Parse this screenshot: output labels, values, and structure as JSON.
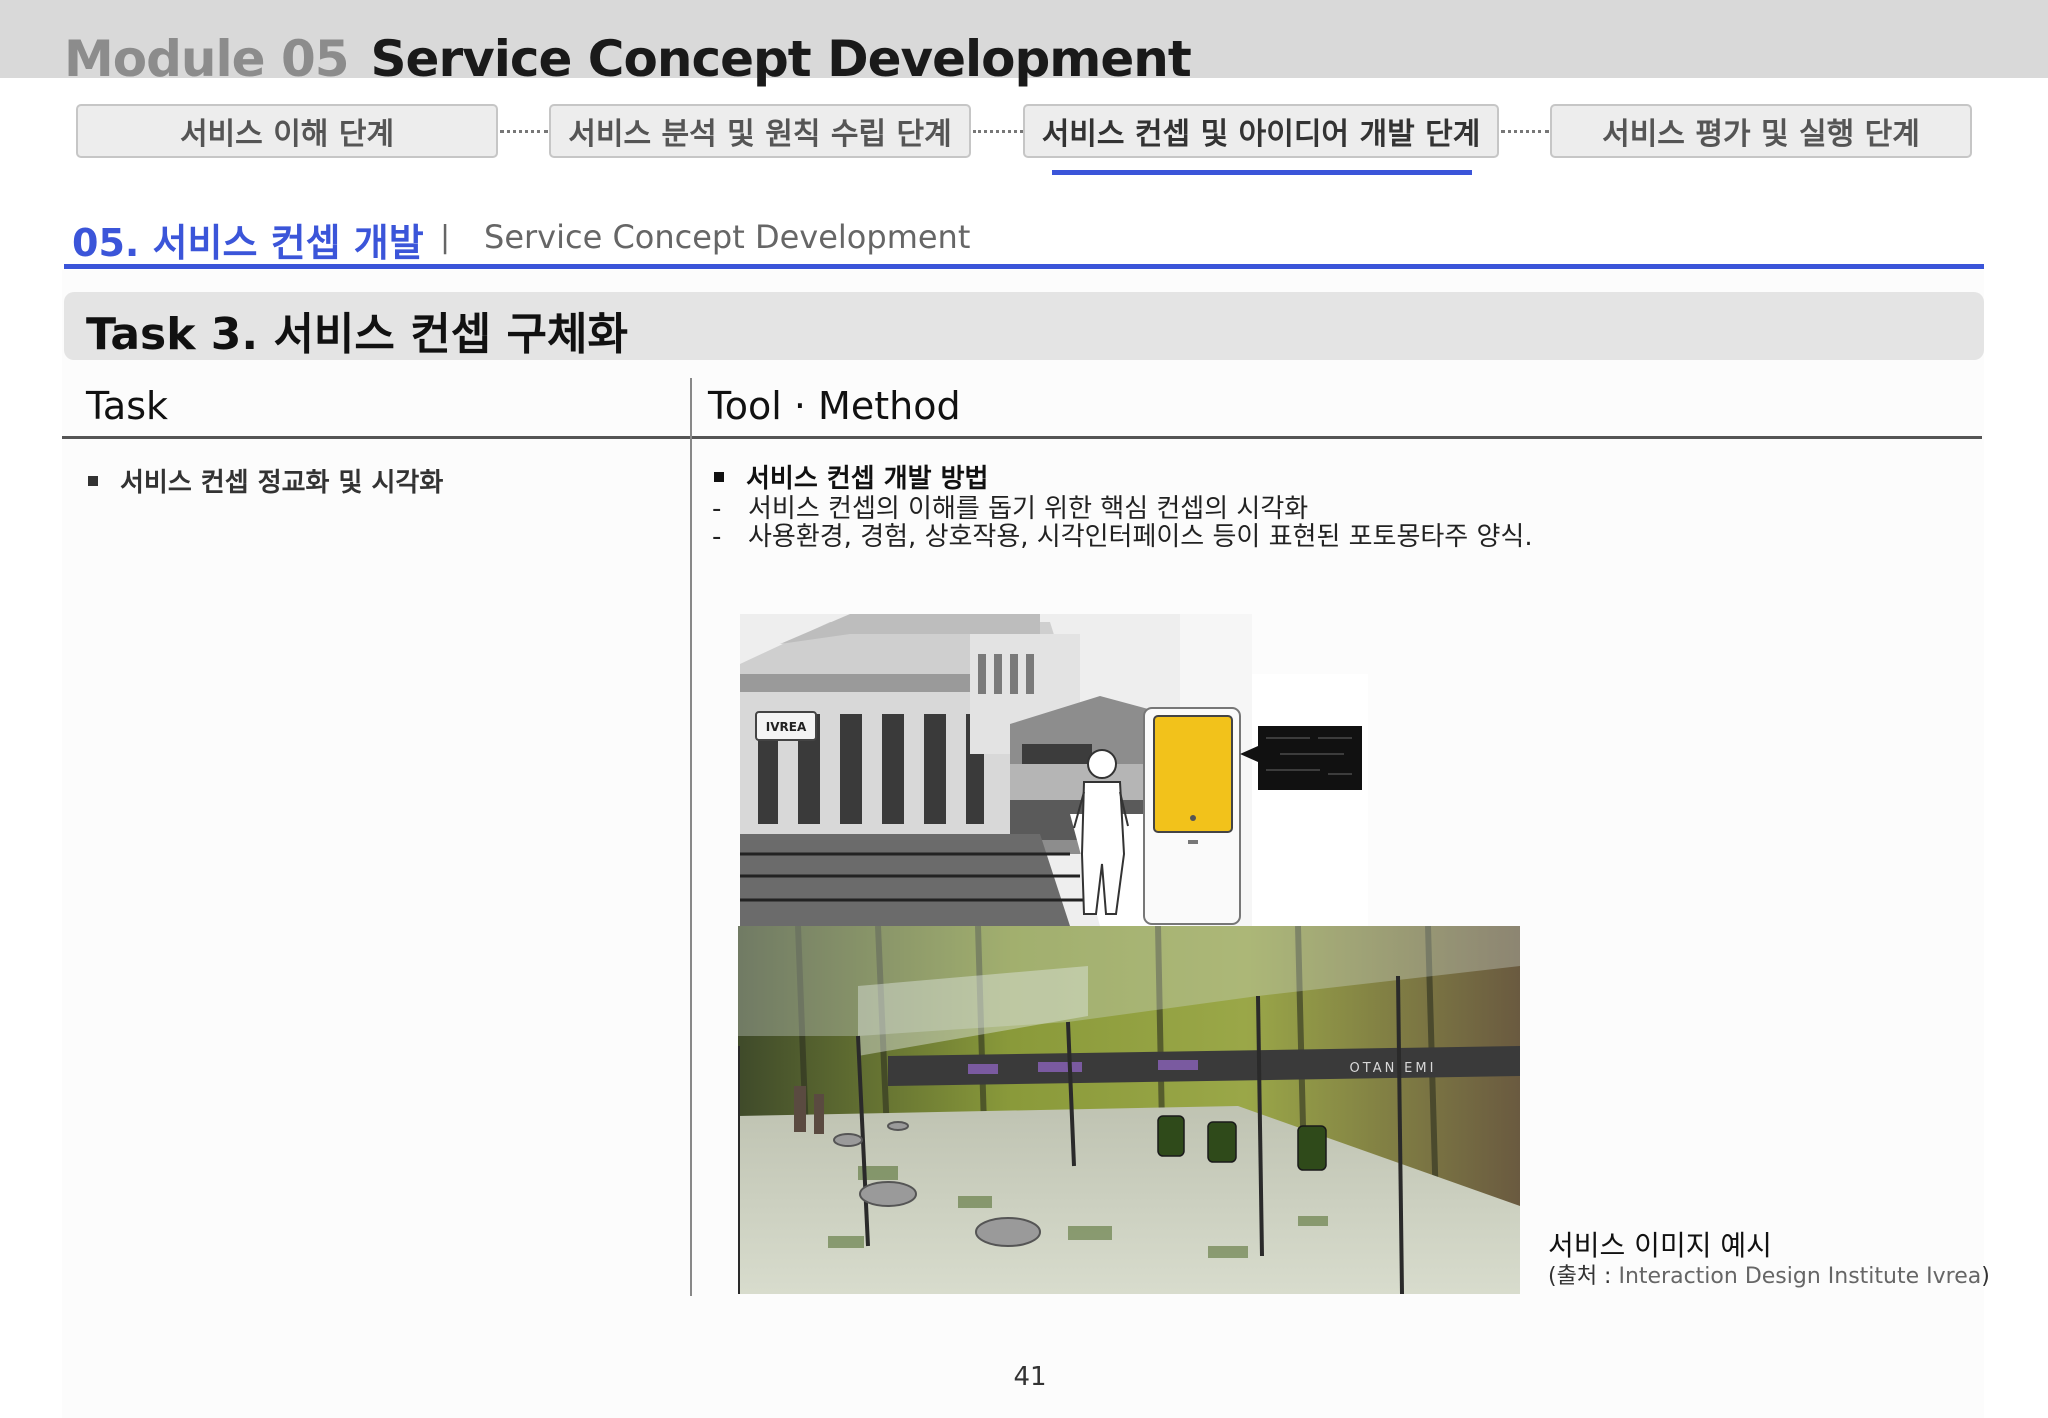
{
  "header": {
    "module_number": "Module 05",
    "module_name": "Service Concept Development"
  },
  "steps": [
    {
      "label": "서비스 이해 단계"
    },
    {
      "label": "서비스 분석 및 원칙 수립 단계"
    },
    {
      "label": "서비스 컨셉 및 아이디어 개발 단계"
    },
    {
      "label": "서비스 평가 및 실행 단계"
    }
  ],
  "active_step": "서비스 컨셉 및 아이디어 개발 단계",
  "section": {
    "title": "05. 서비스 컨셉 개발",
    "separator": "|",
    "subtitle": "Service Concept Development"
  },
  "task_header": "Task 3. 서비스 컨셉 구체화",
  "table": {
    "col_task": "Task",
    "col_method": "Tool · Method",
    "task_item": "서비스 컨셉 정교화 및 시각화",
    "method_title": "서비스 컨셉 개발 방법",
    "method_lines": [
      "서비스 컨셉의 이해를 돕기 위한 핵심 컨셉의 시각화",
      "사용환경, 경험, 상호작용, 시각인터페이스 등이 표현된 포토몽타주 양식."
    ]
  },
  "images": {
    "station_sign": "IVREA",
    "platform_sign": "OTANIEMI"
  },
  "caption": {
    "title": "서비스 이미지 예시",
    "source_prefix": "(출처 : ",
    "source_name": "Interaction Design Institute Ivrea",
    "source_suffix": ")"
  },
  "page_number": "41",
  "colors": {
    "accent": "#3b55d9",
    "header_band": "#d9d9d9",
    "kiosk_yellow": "#f2c21b"
  }
}
